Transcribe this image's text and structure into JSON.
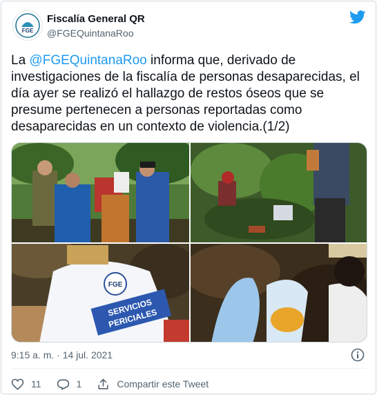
{
  "author": {
    "display_name": "Fiscalía General QR",
    "handle": "@FGEQuintanaRoo",
    "avatar_label": "FGE"
  },
  "tweet": {
    "lead": "La ",
    "mention": "@FGEQuintanaRoo",
    "body": " informa que, derivado de investigaciones de la fiscalía de personas desaparecidas, el día ayer se realizó el hallazgo de restos óseos que se presume pertenecen a personas reportadas como desaparecidas en un contexto de violencia.(1/2)"
  },
  "media": {
    "vest_logo": "FGE",
    "vest_text_line1": "SERVICIOS",
    "vest_text_line2": "PERICIALES"
  },
  "meta": {
    "timestamp": "9:15 a. m. · 14 jul. 2021"
  },
  "actions": {
    "likes": "11",
    "replies": "1",
    "share_label": "Compartir este Tweet"
  },
  "colors": {
    "accent": "#1d9bf0",
    "muted": "#536471",
    "text": "#0f1419"
  }
}
